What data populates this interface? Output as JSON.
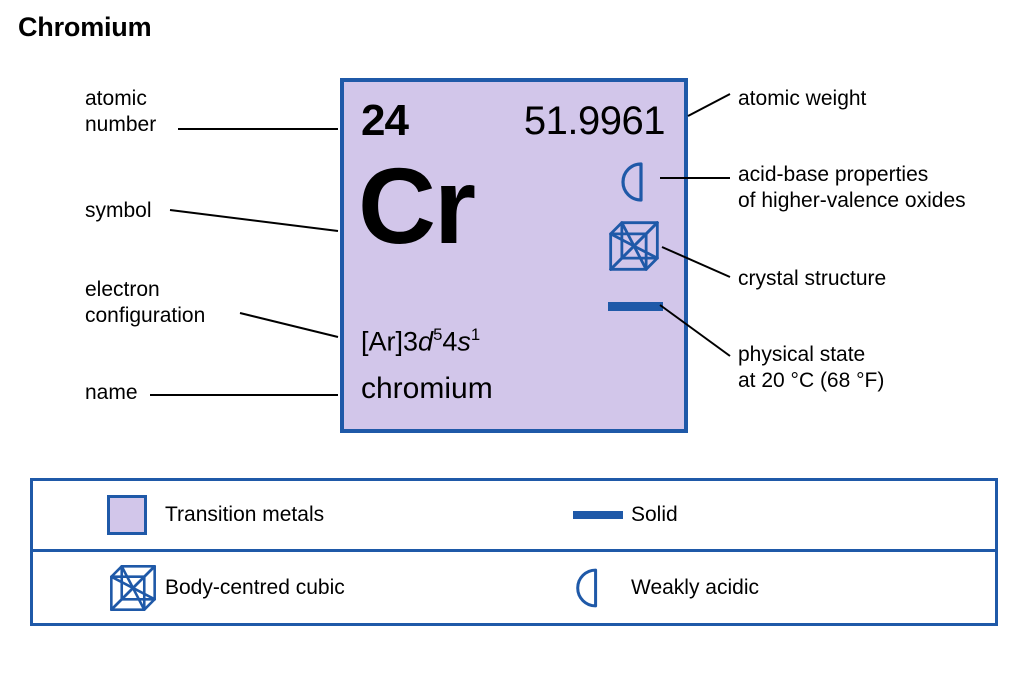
{
  "title": "Chromium",
  "colors": {
    "cell_fill": "#d2c6ea",
    "border_blue": "#1f59a8",
    "text": "#000000",
    "background": "#ffffff"
  },
  "element": {
    "atomic_number": "24",
    "atomic_weight": "51.9961",
    "symbol": "Cr",
    "electron_configuration": {
      "full": "[Ar]3d54s1",
      "prefix": "[Ar]3",
      "orbital1": "d",
      "exponent1": "5",
      "mid": "4",
      "orbital2": "s",
      "exponent2": "1"
    },
    "name": "chromium",
    "icons": {
      "acid_base": "half-disc-weakly-acidic-icon",
      "crystal_structure": "body-centred-cubic-icon",
      "physical_state": "solid-bar-icon"
    }
  },
  "callouts": {
    "left": [
      {
        "id": "atomic-number",
        "label": "atomic\nnumber"
      },
      {
        "id": "symbol",
        "label": "symbol"
      },
      {
        "id": "electron-configuration",
        "label": "electron\nconfiguration"
      },
      {
        "id": "name",
        "label": "name"
      }
    ],
    "right": [
      {
        "id": "atomic-weight",
        "label": "atomic weight"
      },
      {
        "id": "acid-base",
        "label": "acid-base properties\nof higher-valence oxides"
      },
      {
        "id": "crystal-structure",
        "label": "crystal structure"
      },
      {
        "id": "physical-state",
        "label": "physical state\nat 20 °C (68 °F)"
      }
    ]
  },
  "legend": {
    "rows": [
      {
        "entries": [
          {
            "icon": "purple-square-swatch-icon",
            "label": "Transition metals"
          },
          {
            "icon": "solid-bar-icon",
            "label": "Solid"
          }
        ]
      },
      {
        "entries": [
          {
            "icon": "body-centred-cubic-icon",
            "label": "Body-centred cubic"
          },
          {
            "icon": "half-disc-weakly-acidic-icon",
            "label": "Weakly acidic"
          }
        ]
      }
    ]
  }
}
